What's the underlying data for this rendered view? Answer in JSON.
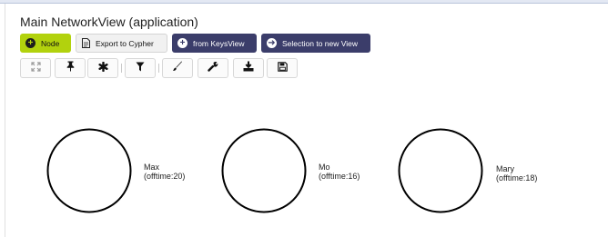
{
  "view": {
    "title": "Main NetworkView (application)"
  },
  "buttons": {
    "node": "Node",
    "export": "Export to Cypher",
    "from_keys": "from KeysView",
    "selection": "Selection to new View"
  },
  "tools": [
    {
      "name": "expand-icon"
    },
    {
      "name": "pin-icon"
    },
    {
      "name": "asterisk-icon"
    },
    {
      "name": "filter-icon"
    },
    {
      "name": "brush-icon"
    },
    {
      "name": "wrench-icon"
    },
    {
      "name": "download-icon"
    },
    {
      "name": "save-icon"
    }
  ],
  "nodes": [
    {
      "name": "Max",
      "detail": "(offtime:20)"
    },
    {
      "name": "Mo",
      "detail": "(offtime:16)"
    },
    {
      "name": "Mary",
      "detail": "(offtime:18)"
    }
  ],
  "colors": {
    "green": "#b2d20d",
    "navy": "#3b3d6a"
  }
}
